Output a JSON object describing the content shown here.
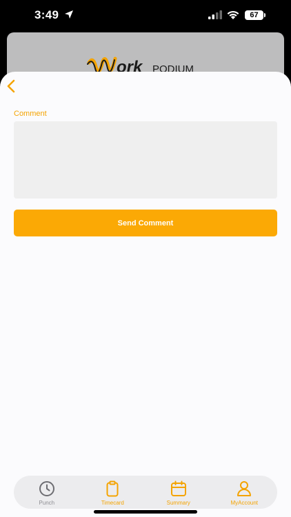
{
  "status_bar": {
    "time": "3:49",
    "battery": "67",
    "icons": [
      "location-arrow-icon",
      "signal-icon",
      "wifi-icon",
      "battery-icon"
    ]
  },
  "background": {
    "logo_text_main": "ork",
    "logo_text_suffix": "PODIUM"
  },
  "form": {
    "comment_label": "Comment",
    "comment_value": "",
    "send_label": "Send Comment"
  },
  "tabs": [
    {
      "label": "Punch",
      "icon": "clock-icon",
      "active": false
    },
    {
      "label": "Timecard",
      "icon": "clipboard-icon",
      "active": true
    },
    {
      "label": "Summary",
      "icon": "calendar-icon",
      "active": true
    },
    {
      "label": "MyAccount",
      "icon": "person-icon",
      "active": true
    }
  ],
  "colors": {
    "accent": "#F4A300",
    "button": "#FBA905",
    "inactive": "#8E8E93",
    "sheet": "#FBFBFD",
    "field": "#EFEFEF"
  }
}
